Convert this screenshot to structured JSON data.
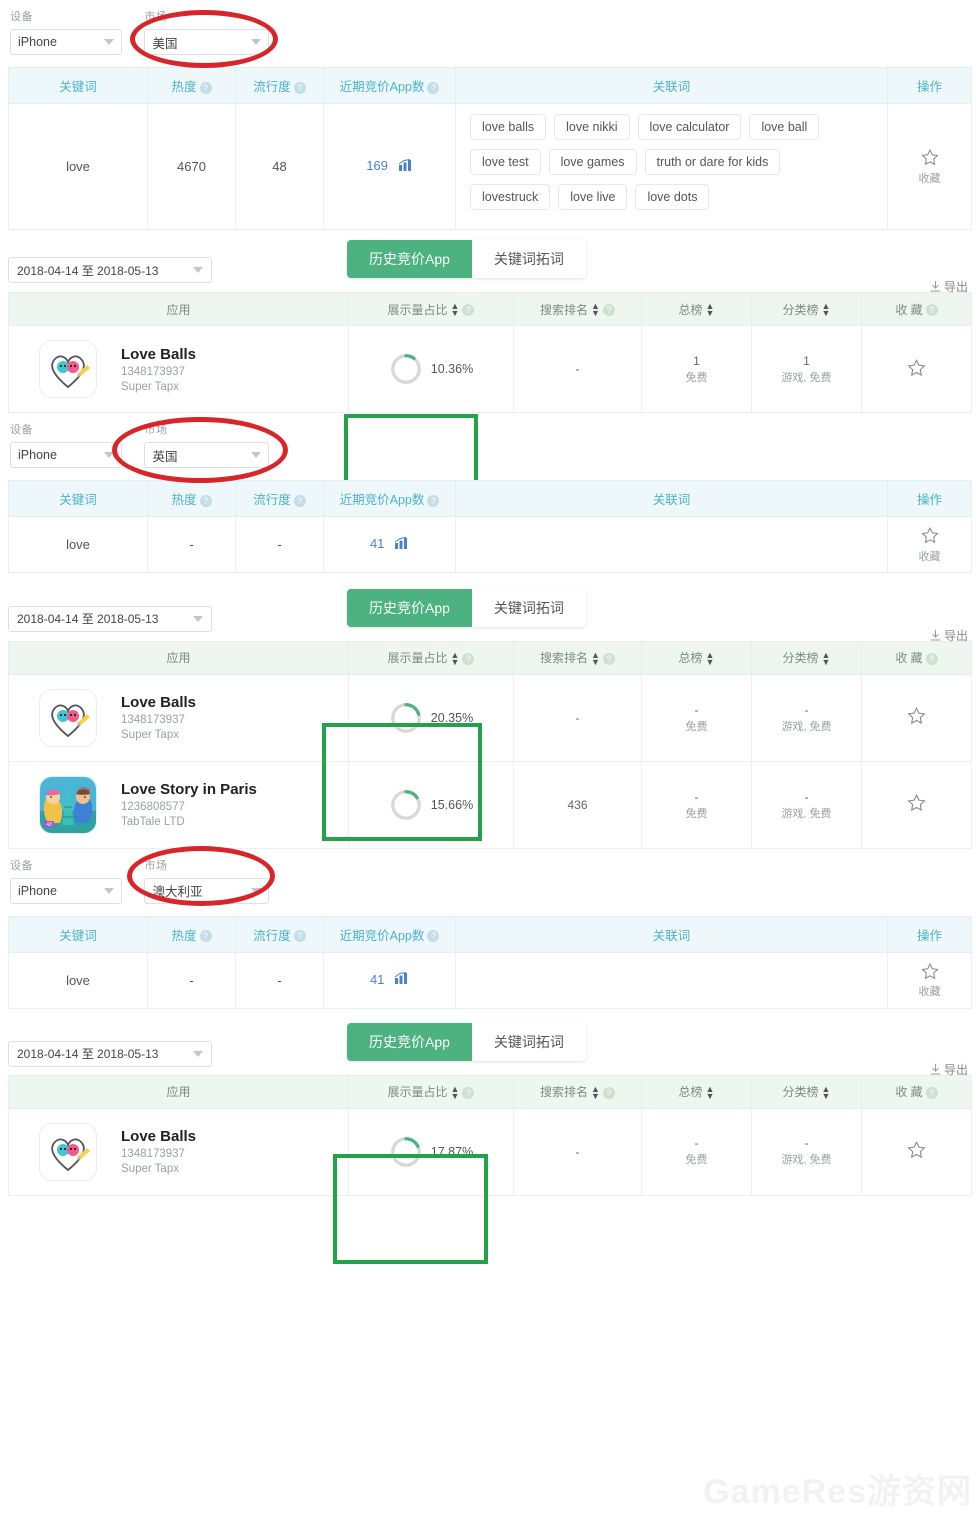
{
  "filters": {
    "device_label": "设备",
    "market_label": "市场",
    "device_value": "iPhone",
    "markets": [
      "美国",
      "英国",
      "澳大利亚"
    ]
  },
  "keyword_table": {
    "headers": {
      "keyword": "关键词",
      "heat": "热度",
      "popularity": "流行度",
      "recent_bid_apps": "近期竞价App数",
      "related": "关联词",
      "action": "操作"
    },
    "favorite_label": "收藏",
    "rows": [
      {
        "keyword": "love",
        "heat": "4670",
        "popularity": "48",
        "recent_bid_apps": "169",
        "related": [
          "love balls",
          "love nikki",
          "love calculator",
          "love ball",
          "love test",
          "love games",
          "truth or dare for kids",
          "lovestruck",
          "love live",
          "love dots"
        ]
      },
      {
        "keyword": "love",
        "heat": "-",
        "popularity": "-",
        "recent_bid_apps": "41",
        "related": []
      },
      {
        "keyword": "love",
        "heat": "-",
        "popularity": "-",
        "recent_bid_apps": "41",
        "related": []
      }
    ]
  },
  "tabs": {
    "active": "历史竞价App",
    "inactive": "关键词拓词"
  },
  "date_range": "2018-04-14 至 2018-05-13",
  "export_label": "导出",
  "results_table": {
    "headers": {
      "app": "应用",
      "impression_share": "展示量占比",
      "search_rank": "搜索排名",
      "overall_rank": "总榜",
      "category_rank": "分类榜",
      "favorite": "收 藏"
    },
    "sections": [
      {
        "market": "美国",
        "rows": [
          {
            "name": "Love Balls",
            "app_id": "1348173937",
            "developer": "Super Tapx",
            "icon": "love-balls-icon",
            "impression_share": "10.36%",
            "impression_value": 10.36,
            "search_rank": "-",
            "overall_rank": "1",
            "overall_rank_sub": "免费",
            "category_rank": "1",
            "category_rank_sub": "游戏, 免费",
            "highlighted": true
          }
        ]
      },
      {
        "market": "英国",
        "rows": [
          {
            "name": "Love Balls",
            "app_id": "1348173937",
            "developer": "Super Tapx",
            "icon": "love-balls-icon",
            "impression_share": "20.35%",
            "impression_value": 20.35,
            "search_rank": "-",
            "overall_rank": "-",
            "overall_rank_sub": "免费",
            "category_rank": "-",
            "category_rank_sub": "游戏, 免费",
            "highlighted": true
          },
          {
            "name": "Love Story in Paris",
            "app_id": "1236808577",
            "developer": "TabTale LTD",
            "icon": "love-story-paris-icon",
            "impression_share": "15.66%",
            "impression_value": 15.66,
            "search_rank": "436",
            "overall_rank": "-",
            "overall_rank_sub": "免费",
            "category_rank": "-",
            "category_rank_sub": "游戏, 免费",
            "highlighted": false
          }
        ]
      },
      {
        "market": "澳大利亚",
        "rows": [
          {
            "name": "Love Balls",
            "app_id": "1348173937",
            "developer": "Super Tapx",
            "icon": "love-balls-icon",
            "impression_share": "17.87%",
            "impression_value": 17.87,
            "search_rank": "-",
            "overall_rank": "-",
            "overall_rank_sub": "免费",
            "category_rank": "-",
            "category_rank_sub": "游戏, 免费",
            "highlighted": true
          }
        ]
      }
    ]
  },
  "watermark": "GameRes游资网",
  "colors": {
    "accent_green": "#4cb380",
    "highlight_green": "#22a34a",
    "header_blue": "#4ab3c8",
    "link_blue": "#4a82c8",
    "annotation_red": "#d8252a"
  }
}
